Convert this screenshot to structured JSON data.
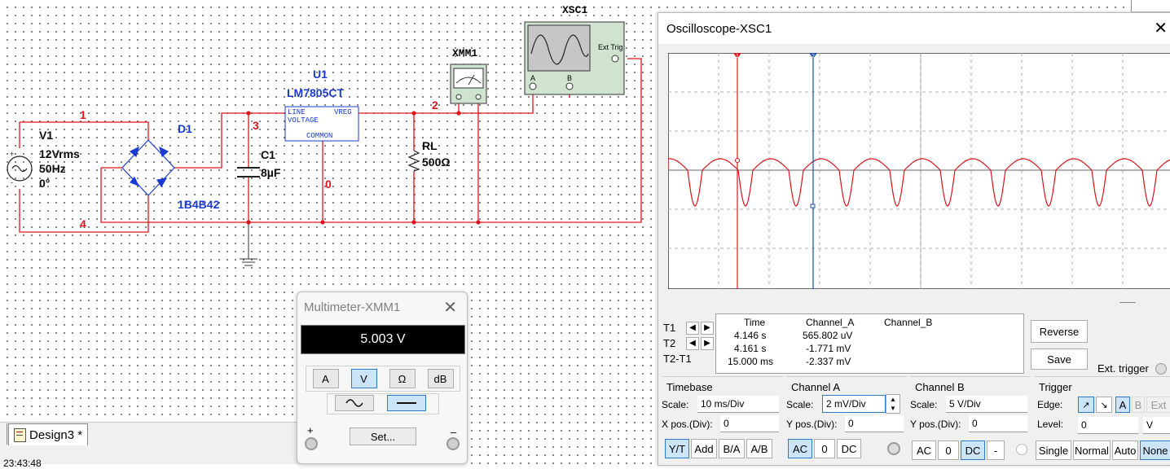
{
  "schematic": {
    "components": {
      "source_name": "V1",
      "source_voltage": "12Vrms",
      "source_freq": "50Hz",
      "source_phase": "0°",
      "bridge_name": "D1",
      "bridge_part": "1B4B42",
      "cap_name": "C1",
      "cap_value": "8µF",
      "reg_name": "U1",
      "reg_part": "LM7805CT",
      "reg_pin_line": "LINE",
      "reg_pin_vreg": "VREG",
      "reg_pin_voltage": "VOLTAGE",
      "reg_pin_common": "COMMON",
      "load_name": "RL",
      "load_value": "500Ω",
      "meter_name": "XMM1",
      "scope_name": "XSC1",
      "scope_ext_trig": "Ext Trig",
      "scope_a": "A",
      "scope_b": "B"
    },
    "nets": {
      "n1": "1",
      "n2": "2",
      "n3": "3",
      "n4": "4",
      "n0": "0"
    },
    "colors": {
      "wire": "#e0141c",
      "label": "#1a3bd6",
      "net": "#e0141c"
    }
  },
  "tab": {
    "label": "Design3 *"
  },
  "status": {
    "time": "23:43:48"
  },
  "multimeter": {
    "title": "Multimeter-XMM1",
    "reading": "5.003 V",
    "modes": [
      "A",
      "V",
      "Ω",
      "dB"
    ],
    "active_mode": "V",
    "set_label": "Set...",
    "plus": "+",
    "minus": "–"
  },
  "oscilloscope": {
    "title": "Oscilloscope-XSC1",
    "cursor_labels": [
      "T1",
      "T2",
      "T2-T1"
    ],
    "table_headers": [
      "Time",
      "Channel_A",
      "Channel_B"
    ],
    "rows": [
      {
        "label": "T1",
        "time": "4.146 s",
        "a": "565.802 uV",
        "b": ""
      },
      {
        "label": "T2",
        "time": "4.161 s",
        "a": "-1.771 mV",
        "b": ""
      },
      {
        "label": "T2-T1",
        "time": "15.000 ms",
        "a": "-2.337 mV",
        "b": ""
      }
    ],
    "reverse_label": "Reverse",
    "save_label": "Save",
    "ext_trigger_label": "Ext. trigger",
    "timebase": {
      "title": "Timebase",
      "scale_label": "Scale:",
      "scale": "10 ms/Div",
      "xpos_label": "X pos.(Div):",
      "xpos": "0",
      "buttons": [
        "Y/T",
        "Add",
        "B/A",
        "A/B"
      ]
    },
    "channel_a": {
      "title": "Channel A",
      "scale_label": "Scale:",
      "scale": "2 mV/Div",
      "ypos_label": "Y pos.(Div):",
      "ypos": "0",
      "buttons": [
        "AC",
        "0",
        "DC"
      ]
    },
    "channel_b": {
      "title": "Channel B",
      "scale_label": "Scale:",
      "scale": "5  V/Div",
      "ypos_label": "Y pos.(Div):",
      "ypos": "0",
      "buttons": [
        "AC",
        "0",
        "DC",
        "-"
      ]
    },
    "trigger": {
      "title": "Trigger",
      "edge_label": "Edge:",
      "edge_a": "A",
      "edge_b": "B",
      "edge_ext": "Ext",
      "level_label": "Level:",
      "level": "0",
      "level_unit": "V",
      "buttons": [
        "Single",
        "Normal",
        "Auto",
        "None"
      ]
    },
    "trace_color": "#d8141c"
  }
}
